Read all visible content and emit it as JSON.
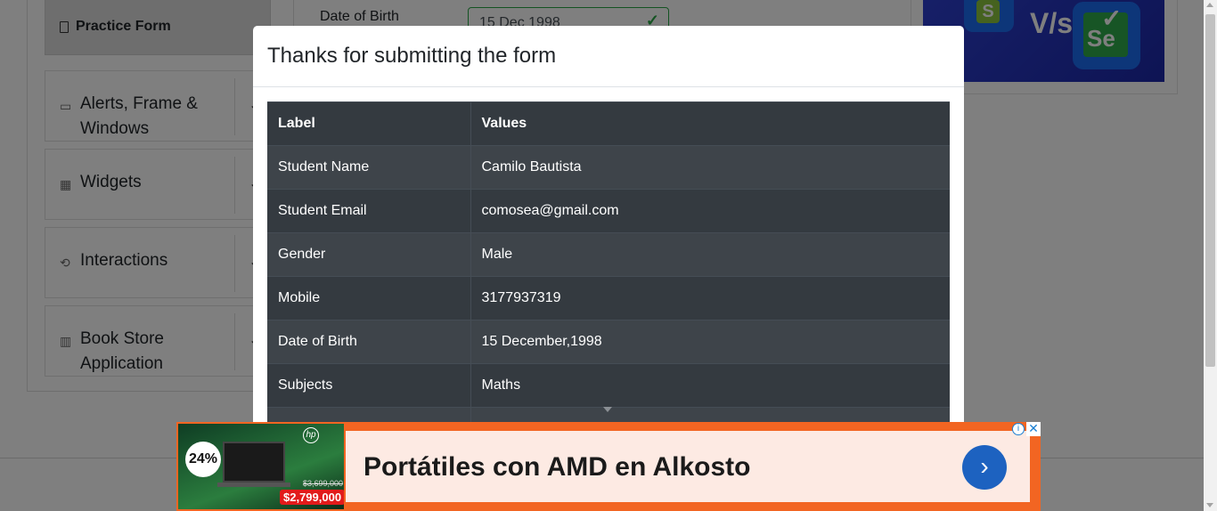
{
  "sidebar": {
    "active_item": "Practice Form",
    "groups": [
      {
        "label_line1": "Alerts, Frame &",
        "label_line2": "Windows"
      },
      {
        "label_line1": "Widgets"
      },
      {
        "label_line1": "Interactions"
      },
      {
        "label_line1": "Book Store",
        "label_line2": "Application"
      }
    ]
  },
  "form": {
    "dob_label": "Date of Birth",
    "dob_value": "15 Dec 1998"
  },
  "side_ad": {
    "vs_text": "V/s",
    "left_letter": "S",
    "right_letters": "Se"
  },
  "modal": {
    "title": "Thanks for submitting the form",
    "columns": [
      "Label",
      "Values"
    ],
    "rows": [
      {
        "label": "Student Name",
        "value": "Camilo Bautista"
      },
      {
        "label": "Student Email",
        "value": "comosea@gmail.com"
      },
      {
        "label": "Gender",
        "value": "Male"
      },
      {
        "label": "Mobile",
        "value": "3177937319"
      },
      {
        "label": "Date of Birth",
        "value": "15 December,1998"
      },
      {
        "label": "Subjects",
        "value": "Maths"
      }
    ]
  },
  "bottom_ad": {
    "headline": "Portátiles con AMD en Alkosto",
    "discount": "24%",
    "old_price": "$3,699,000",
    "price": "$2,799,000",
    "brand": "hp"
  },
  "colors": {
    "table_bg": "#343a40",
    "table_stripe": "#3e444a",
    "ad_orange": "#f26522",
    "ad_button": "#1d62c0",
    "valid_green": "#28a745"
  }
}
